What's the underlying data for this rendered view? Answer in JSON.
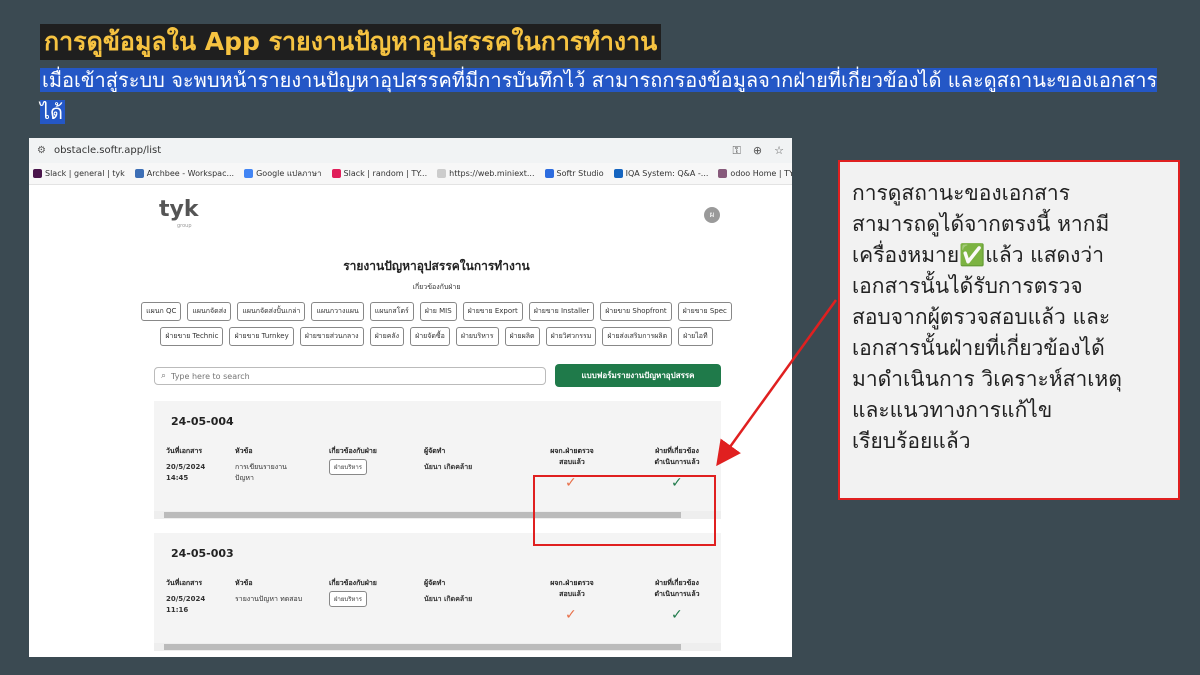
{
  "slide": {
    "title": "การดูข้อมูลใน App รายงานปัญหาอุปสรรคในการทำงาน",
    "subtitle": "เมื่อเข้าสู่ระบบ จะพบหน้ารายงานปัญหาอุปสรรคที่มีการบันทึกไว้ สามารถกรองข้อมูลจากฝ่ายที่เกี่ยวข้องได้ และดูสถานะของเอกสารได้"
  },
  "browser": {
    "url": "obstacle.softr.app/list",
    "bookmarks": [
      {
        "label": "Slack | general | tyk",
        "color": "#4a154b"
      },
      {
        "label": "Archbee - Workspac...",
        "color": "#3d6fb6"
      },
      {
        "label": "Google แปลภาษา",
        "color": "#4285f4"
      },
      {
        "label": "Slack | random | TY...",
        "color": "#e01e5a"
      },
      {
        "label": "https://web.miniext...",
        "color": "#cccccc"
      },
      {
        "label": "Softr Studio",
        "color": "#2d6cdf"
      },
      {
        "label": "IQA System: Q&A -...",
        "color": "#1565c0"
      },
      {
        "label": "odoo Home | TYK G...",
        "color": "#875a7b"
      }
    ]
  },
  "app": {
    "logo": "tyk",
    "logo_sub": "group",
    "avatar": "ผ",
    "report_title": "รายงานปัญหาอุปสรรคในการทำงาน",
    "dept_label": "เกี่ยวข้องกับฝ่าย",
    "dept_row1": [
      "แผนก QC",
      "แผนกจัดส่ง",
      "แผนกจัดส่งปั้นเกล่า",
      "แผนกวางแผน",
      "แผนกสโตร์",
      "ฝ่าย MIS",
      "ฝ่ายขาย Export",
      "ฝ่ายขาย Installer",
      "ฝ่ายขาย Shopfront",
      "ฝ่ายขาย Spec"
    ],
    "dept_row2": [
      "ฝ่ายขาย Technic",
      "ฝ่ายขาย Turnkey",
      "ฝ่ายขายส่วนกลาง",
      "ฝ่ายคลัง",
      "ฝ่ายจัดซื้อ",
      "ฝ่ายบริหาร",
      "ฝ่ายผลิต",
      "ฝ่ายวิศวกรรม",
      "ฝ่ายส่งเสริมการผลิต",
      "ฝ่ายไอที"
    ],
    "search_placeholder": "Type here to search",
    "form_button": "แบบฟอร์มรายงานปัญหาอุปสรรค",
    "columns": {
      "date": "วันที่เอกสาร",
      "topic": "หัวข้อ",
      "dept": "เกี่ยวข้องกับฝ่าย",
      "manager": "ผู้จัดทำ",
      "qa_line1": "ผจก.ฝ่ายตรวจ",
      "qa_line2": "สอบแล้ว",
      "rel_line1": "ฝ่ายที่เกี่ยวข้อง",
      "rel_line2": "ดำเนินการแล้ว"
    },
    "records": [
      {
        "id": "24-05-004",
        "date": "20/5/2024",
        "time": "14:45",
        "topic_l1": "การเขียนรายงาน",
        "topic_l2": "ปัญหา",
        "dept": "ฝ่ายบริหาร",
        "author": "นัยนา เกิดคล้าย",
        "qa_check": "✓",
        "rel_check": "✓"
      },
      {
        "id": "24-05-003",
        "date": "20/5/2024",
        "time": "11:16",
        "topic_l1": "รายงานปัญหา ทดสอบ",
        "topic_l2": "",
        "dept": "ฝ่ายบริหาร",
        "author": "นัยนา เกิดคล้าย",
        "qa_check": "✓",
        "rel_check": "✓"
      }
    ]
  },
  "note": {
    "text": "การดูสถานะของเอกสาร\nสามารถดูได้จากตรงนี้ หากมี\nเครื่องหมาย✅แล้ว แสดงว่า\nเอกสารนั้นได้รับการตรวจ\nสอบจากผู้ตรวจสอบแล้ว และ\nเอกสารนั้นฝ่ายที่เกี่ยวข้องได้\nมาดำเนินการ วิเคราะห์สาเหตุ\nและแนวทางการแก้ไข\nเรียบร้อยแล้ว"
  },
  "colors": {
    "accent_green": "#1f7a4a",
    "highlight_red": "#e02020",
    "title_yellow": "#f6c341",
    "subtitle_blue": "#2457c6"
  }
}
